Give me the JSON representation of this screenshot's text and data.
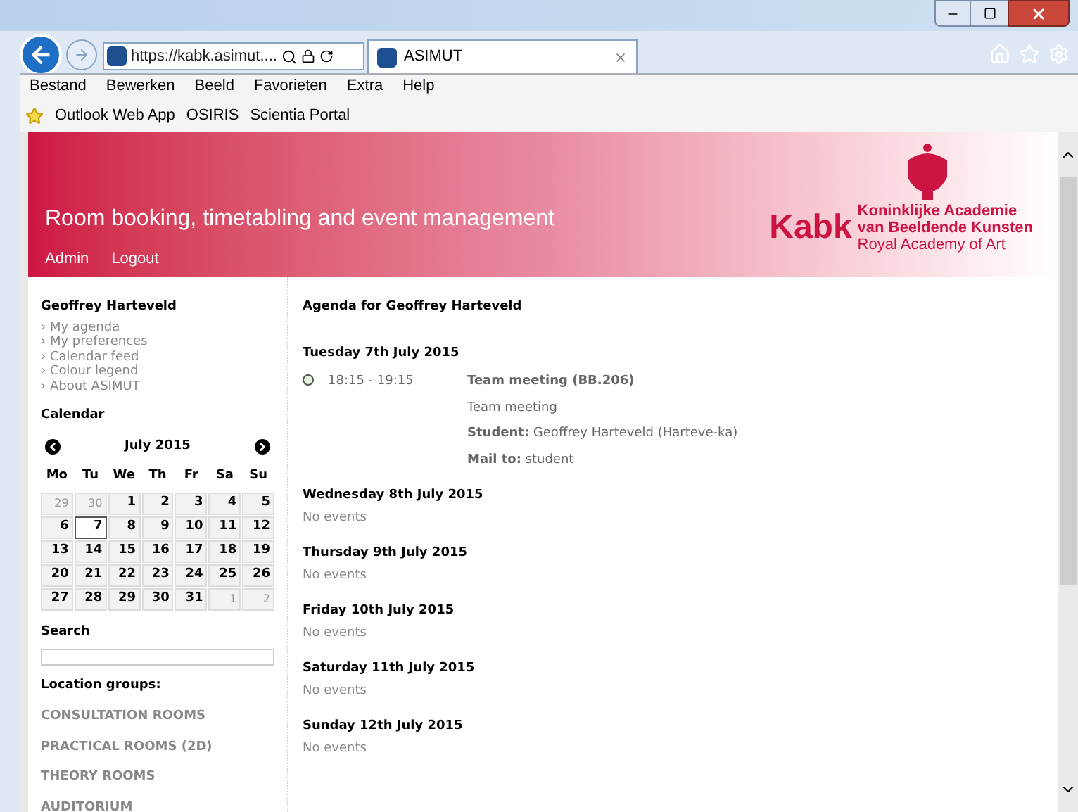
{
  "browser": {
    "address": "https://kabk.asimut....",
    "tab_title": "ASIMUT",
    "menu": [
      "Bestand",
      "Bewerken",
      "Beeld",
      "Favorieten",
      "Extra",
      "Help"
    ],
    "favorites": [
      "Outlook Web App",
      "OSIRIS",
      "Scientia Portal"
    ]
  },
  "header": {
    "title": "Room booking, timetabling and event management",
    "links": [
      "Admin",
      "Logout"
    ],
    "logo": {
      "wordmark": "Kabk",
      "lines": [
        "Koninklijke Academie",
        "van Beeldende Kunsten",
        "Royal Academy of Art"
      ]
    }
  },
  "sidebar": {
    "user": "Geoffrey Harteveld",
    "bullet": "›",
    "links": [
      "My agenda",
      "My preferences",
      "Calendar feed",
      "Colour legend",
      "About ASIMUT"
    ],
    "calendar": {
      "heading": "Calendar",
      "month": "July 2015",
      "weekdays": [
        "Mo",
        "Tu",
        "We",
        "Th",
        "Fr",
        "Sa",
        "Su"
      ],
      "weeks": [
        [
          {
            "day": "29",
            "muted": true,
            "selected": false
          },
          {
            "day": "30",
            "muted": true,
            "selected": false
          },
          {
            "day": "1",
            "muted": false,
            "selected": false
          },
          {
            "day": "2",
            "muted": false,
            "selected": false
          },
          {
            "day": "3",
            "muted": false,
            "selected": false
          },
          {
            "day": "4",
            "muted": false,
            "selected": false
          },
          {
            "day": "5",
            "muted": false,
            "selected": false
          }
        ],
        [
          {
            "day": "6",
            "muted": false,
            "selected": false
          },
          {
            "day": "7",
            "muted": false,
            "selected": true
          },
          {
            "day": "8",
            "muted": false,
            "selected": false
          },
          {
            "day": "9",
            "muted": false,
            "selected": false
          },
          {
            "day": "10",
            "muted": false,
            "selected": false
          },
          {
            "day": "11",
            "muted": false,
            "selected": false
          },
          {
            "day": "12",
            "muted": false,
            "selected": false
          }
        ],
        [
          {
            "day": "13",
            "muted": false,
            "selected": false
          },
          {
            "day": "14",
            "muted": false,
            "selected": false
          },
          {
            "day": "15",
            "muted": false,
            "selected": false
          },
          {
            "day": "16",
            "muted": false,
            "selected": false
          },
          {
            "day": "17",
            "muted": false,
            "selected": false
          },
          {
            "day": "18",
            "muted": false,
            "selected": false
          },
          {
            "day": "19",
            "muted": false,
            "selected": false
          }
        ],
        [
          {
            "day": "20",
            "muted": false,
            "selected": false
          },
          {
            "day": "21",
            "muted": false,
            "selected": false
          },
          {
            "day": "22",
            "muted": false,
            "selected": false
          },
          {
            "day": "23",
            "muted": false,
            "selected": false
          },
          {
            "day": "24",
            "muted": false,
            "selected": false
          },
          {
            "day": "25",
            "muted": false,
            "selected": false
          },
          {
            "day": "26",
            "muted": false,
            "selected": false
          }
        ],
        [
          {
            "day": "27",
            "muted": false,
            "selected": false
          },
          {
            "day": "28",
            "muted": false,
            "selected": false
          },
          {
            "day": "29",
            "muted": false,
            "selected": false
          },
          {
            "day": "30",
            "muted": false,
            "selected": false
          },
          {
            "day": "31",
            "muted": false,
            "selected": false
          },
          {
            "day": "1",
            "muted": true,
            "selected": false
          },
          {
            "day": "2",
            "muted": true,
            "selected": false
          }
        ]
      ]
    },
    "search": {
      "heading": "Search"
    },
    "location_heading": "Location groups:",
    "location_groups": [
      "CONSULTATION ROOMS",
      "PRACTICAL ROOMS (2D)",
      "THEORY ROOMS",
      "AUDITORIUM"
    ]
  },
  "agenda": {
    "title": "Agenda for Geoffrey Harteveld",
    "days": [
      {
        "date": "Tuesday 7th July 2015",
        "events": [
          {
            "time": "18:15 - 19:15",
            "title": "Team meeting (BB.206)",
            "description": "Team meeting",
            "fields": [
              {
                "label": "Student:",
                "value": "Geoffrey Harteveld (Harteve-ka)"
              },
              {
                "label": "Mail to:",
                "value": "student"
              }
            ]
          }
        ]
      },
      {
        "date": "Wednesday 8th July 2015",
        "empty_text": "No events"
      },
      {
        "date": "Thursday 9th July 2015",
        "empty_text": "No events"
      },
      {
        "date": "Friday 10th July 2015",
        "empty_text": "No events"
      },
      {
        "date": "Saturday 11th July 2015",
        "empty_text": "No events"
      },
      {
        "date": "Sunday 12th July 2015",
        "empty_text": "No events"
      }
    ]
  }
}
